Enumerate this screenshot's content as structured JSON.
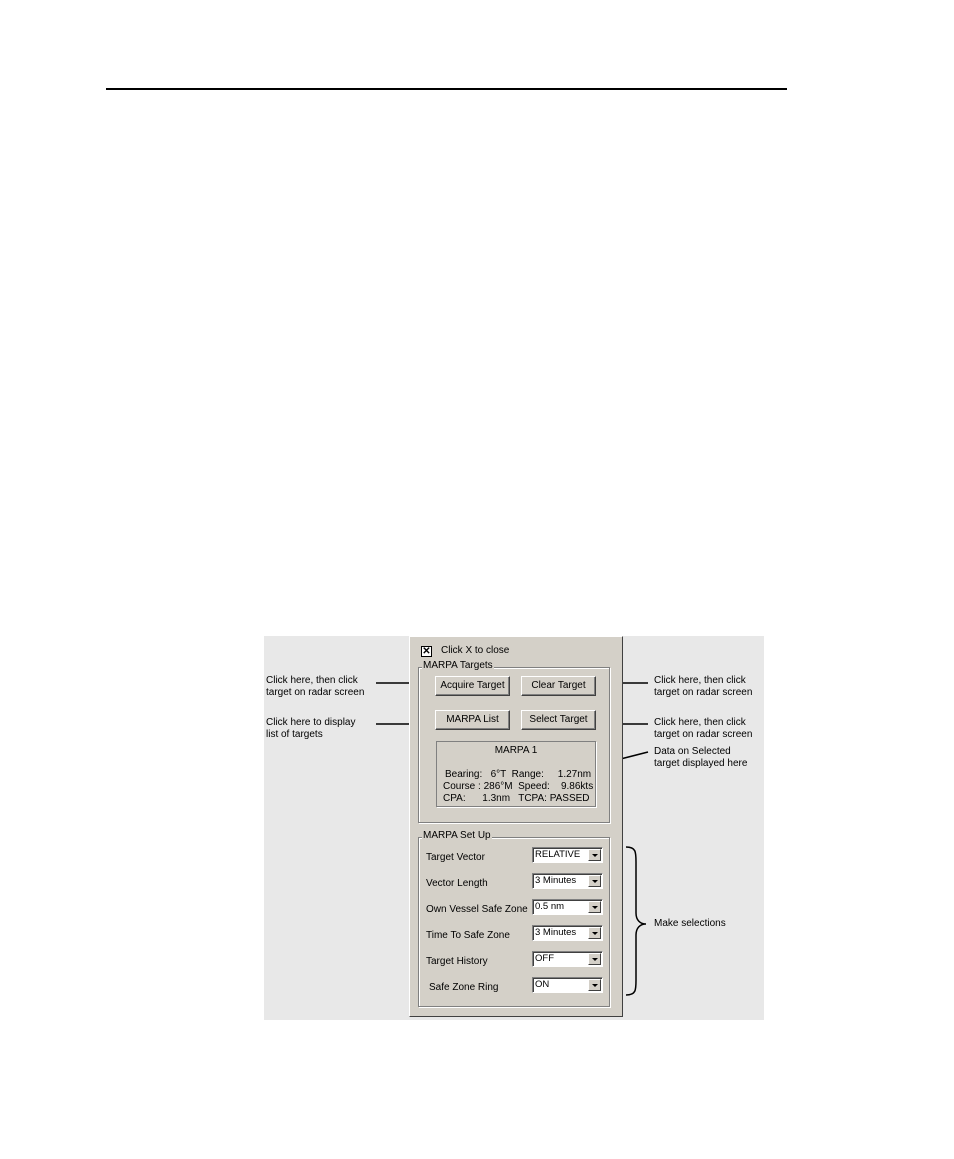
{
  "panel": {
    "close_label": "Click X to close",
    "close_glyph": "✕",
    "targets_group": {
      "title": "MARPA Targets",
      "acquire_label": "Acquire Target",
      "clear_label": "Clear Target",
      "list_label": "MARPA List",
      "select_label": "Select Target",
      "selected": {
        "name": "MARPA 1",
        "line1": "Bearing:   6°T  Range:     1.27nm",
        "line2": "Course : 286°M  Speed:    9.86kts",
        "line3": "CPA:      1.3nm   TCPA: PASSED"
      }
    },
    "setup_group": {
      "title": "MARPA Set Up",
      "rows": [
        {
          "label": "Target Vector",
          "value": "RELATIVE"
        },
        {
          "label": "Vector Length",
          "value": "3 Minutes"
        },
        {
          "label": "Own Vessel Safe Zone",
          "value": "0.5 nm"
        },
        {
          "label": "Time To Safe Zone",
          "value": "3 Minutes"
        },
        {
          "label": "Target History",
          "value": "OFF"
        },
        {
          "label": "Safe Zone Ring",
          "value": "ON"
        }
      ]
    }
  },
  "annotations": {
    "acquire_left": "Click here, then click\ntarget on radar screen",
    "list_left": "Click here to display\nlist of targets",
    "clear_right": "Click here, then click\ntarget on radar screen",
    "select_right": "Click here, then click\ntarget on radar screen",
    "data_right": "Data on Selected\ntarget displayed here",
    "selections_right": "Make selections"
  }
}
